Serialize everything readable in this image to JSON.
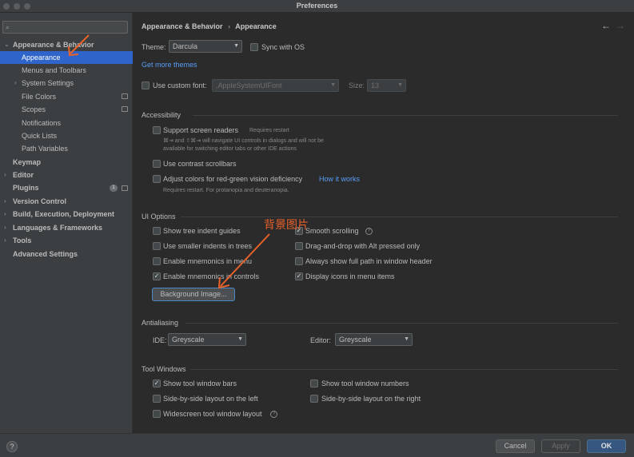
{
  "window": {
    "title": "Preferences"
  },
  "search": {
    "placeholder": "",
    "icon": "search-icon"
  },
  "sidebar": {
    "items": [
      {
        "label": "Appearance & Behavior"
      },
      {
        "label": "Appearance"
      },
      {
        "label": "Menus and Toolbars"
      },
      {
        "label": "System Settings"
      },
      {
        "label": "File Colors"
      },
      {
        "label": "Scopes"
      },
      {
        "label": "Notifications"
      },
      {
        "label": "Quick Lists"
      },
      {
        "label": "Path Variables"
      },
      {
        "label": "Keymap"
      },
      {
        "label": "Editor"
      },
      {
        "label": "Plugins"
      },
      {
        "label": "Version Control"
      },
      {
        "label": "Build, Execution, Deployment"
      },
      {
        "label": "Languages & Frameworks"
      },
      {
        "label": "Tools"
      },
      {
        "label": "Advanced Settings"
      }
    ],
    "plugins_badge": "1"
  },
  "breadcrumb": {
    "parent": "Appearance & Behavior",
    "separator": "›",
    "current": "Appearance"
  },
  "nav": {
    "back": "←",
    "forward": "→"
  },
  "theme": {
    "label": "Theme:",
    "value": "Darcula",
    "sync_label": "Sync with OS",
    "sync_checked": false,
    "get_more": "Get more themes"
  },
  "font": {
    "custom_label": "Use custom font:",
    "custom_checked": false,
    "value": ".AppleSystemUIFont",
    "size_label": "Size:",
    "size_value": "13"
  },
  "accessibility": {
    "title": "Accessibility",
    "screen_readers": {
      "label": "Support screen readers",
      "note": "Requires restart",
      "desc1": "⌘⇥ and ⇧⌘⇥ will navigate UI controls in dialogs and will not be",
      "desc2": "available for switching editor tabs or other IDE actions",
      "checked": false
    },
    "contrast_scrollbars": {
      "label": "Use contrast scrollbars",
      "checked": false
    },
    "red_green": {
      "label": "Adjust colors for red-green vision deficiency",
      "link": "How it works",
      "desc": "Requires restart. For protanopia and deuteranopia.",
      "checked": false
    }
  },
  "ui_options": {
    "title": "UI Options",
    "left": [
      {
        "label": "Show tree indent guides",
        "checked": false
      },
      {
        "label": "Use smaller indents in trees",
        "checked": false
      },
      {
        "label": "Enable mnemonics in menu",
        "checked": false
      },
      {
        "label": "Enable mnemonics in controls",
        "checked": true
      }
    ],
    "right": [
      {
        "label": "Smooth scrolling",
        "checked": true
      },
      {
        "label": "Drag-and-drop with Alt pressed only",
        "checked": false
      },
      {
        "label": "Always show full path in window header",
        "checked": false
      },
      {
        "label": "Display icons in menu items",
        "checked": true
      }
    ],
    "background_button": "Background Image..."
  },
  "antialiasing": {
    "title": "Antialiasing",
    "ide_label": "IDE:",
    "ide_value": "Greyscale",
    "editor_label": "Editor:",
    "editor_value": "Greyscale"
  },
  "tool_windows": {
    "title": "Tool Windows",
    "left": [
      {
        "label": "Show tool window bars",
        "checked": true
      },
      {
        "label": "Side-by-side layout on the left",
        "checked": false
      },
      {
        "label": "Widescreen tool window layout",
        "checked": false
      }
    ],
    "right": [
      {
        "label": "Show tool window numbers",
        "checked": false
      },
      {
        "label": "Side-by-side layout on the right",
        "checked": false
      }
    ]
  },
  "annotation": {
    "text": "背景图片",
    "color": "#e8622a"
  },
  "footer": {
    "help": "?",
    "cancel": "Cancel",
    "apply": "Apply",
    "ok": "OK"
  },
  "colors": {
    "accent": "#2f65ca",
    "link": "#589df6",
    "ok_button": "#365880",
    "background": "#2b2b2b",
    "sidebar": "#3c3f41"
  }
}
